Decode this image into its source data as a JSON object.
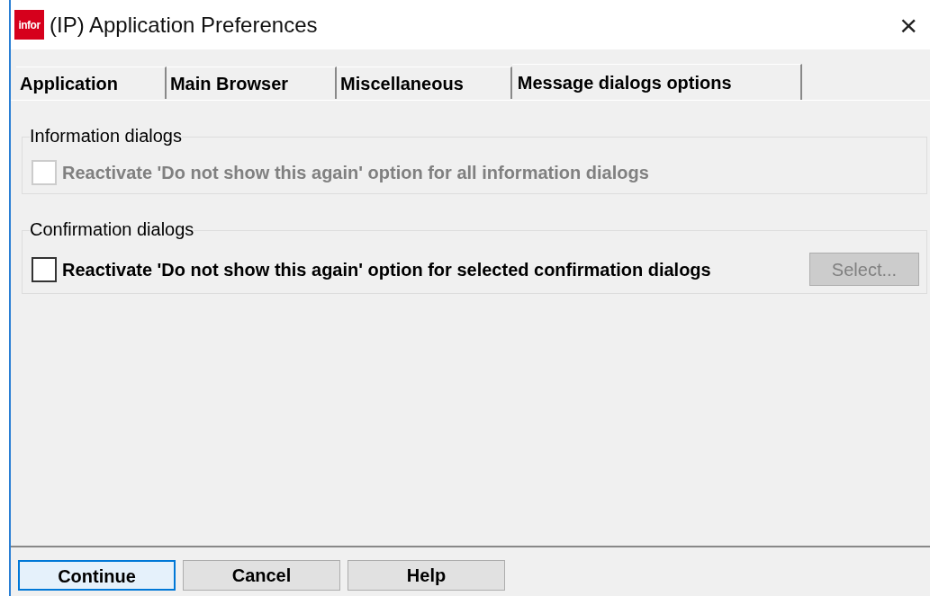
{
  "window": {
    "logo": "infor",
    "title": "(IP) Application Preferences",
    "close": "×"
  },
  "tabs": [
    {
      "label": "Application",
      "selected": false
    },
    {
      "label": "Main Browser",
      "selected": false
    },
    {
      "label": "Miscellaneous",
      "selected": false
    },
    {
      "label": "Message dialogs options",
      "selected": true
    }
  ],
  "groups": [
    {
      "title": "Information dialogs",
      "options": [
        {
          "label": "Reactivate 'Do not show this again' option for all information dialogs",
          "checked": false,
          "disabled": true
        }
      ]
    },
    {
      "title": "Confirmation dialogs",
      "options": [
        {
          "label": "Reactivate 'Do not show this again' option for selected confirmation dialogs",
          "checked": false,
          "disabled": false,
          "button": {
            "label": "Select...",
            "disabled": true
          }
        }
      ]
    }
  ],
  "buttons": [
    {
      "label": "Continue",
      "selected": true
    },
    {
      "label": "Cancel",
      "selected": false
    },
    {
      "label": "Help",
      "selected": false
    }
  ]
}
